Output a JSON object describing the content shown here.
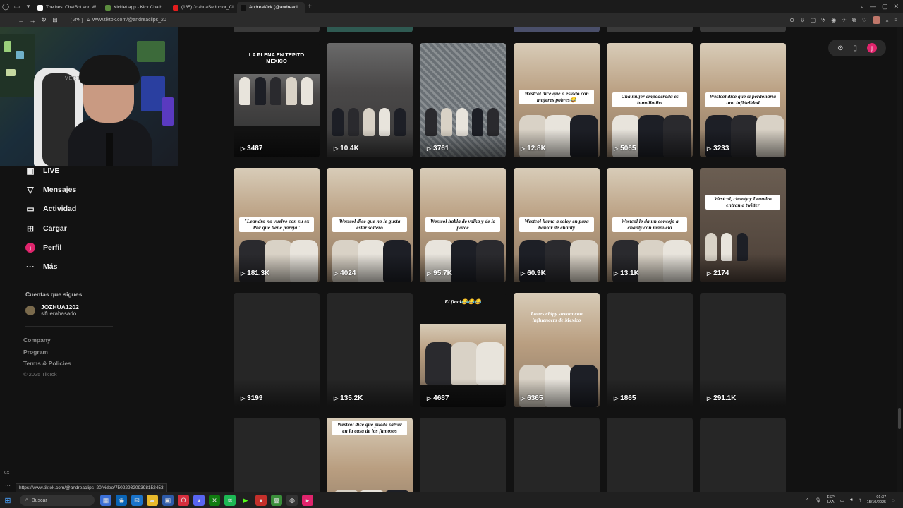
{
  "browser": {
    "tabs": [
      {
        "label": "The best ChatBot and W",
        "color": "#ffffff",
        "active": false
      },
      {
        "label": "Kicklet.app - Kick Chatb",
        "color": "#5b8c3e",
        "active": false
      },
      {
        "label": "(185) JozhuaSeductor_Cl",
        "color": "#e31d1d",
        "active": false
      },
      {
        "label": "AndreaKick (@andreacli",
        "color": "#111111",
        "active": true
      }
    ],
    "new_tab": "+",
    "vpn_label": "VPN",
    "url": "www.tiktok.com/@andreaclips_20",
    "status_url": "https://www.tiktok.com/@andreaclips_20/video/7502293209398152453",
    "zoom_label": "0X"
  },
  "nav": {
    "items": [
      {
        "label": "LIVE",
        "icon": "live-icon",
        "glyph": "▣"
      },
      {
        "label": "Mensajes",
        "icon": "messages-icon",
        "glyph": "▽"
      },
      {
        "label": "Actividad",
        "icon": "activity-icon",
        "glyph": "▭"
      },
      {
        "label": "Cargar",
        "icon": "upload-icon",
        "glyph": "⊞"
      },
      {
        "label": "Perfil",
        "icon": "profile-icon",
        "glyph": "j"
      },
      {
        "label": "Más",
        "icon": "more-icon",
        "glyph": "···"
      }
    ],
    "following_title": "Cuentas que sigues",
    "following": {
      "name": "JOZHUA1202",
      "sub": "sifuerabasado"
    },
    "footer_links": [
      "Company",
      "Program",
      "Terms & Policies"
    ],
    "copyright": "© 2025 TikTok"
  },
  "pill": {
    "profile_letter": "j"
  },
  "videos": [
    {
      "views": "3487",
      "title": "LA PLENA EN TEPITO MEXICO",
      "caption": "",
      "bg": "street"
    },
    {
      "views": "10.4K",
      "title": "",
      "caption": "",
      "bg": "street"
    },
    {
      "views": "3761",
      "title": "",
      "caption": "",
      "bg": "fence"
    },
    {
      "views": "12.8K",
      "title": "",
      "caption": "Westcol dice que a estado con mujeres pobres😂",
      "bg": "room"
    },
    {
      "views": "5065",
      "title": "",
      "caption": "Una mujer empoderada es humillatiba",
      "bg": "room"
    },
    {
      "views": "3233",
      "title": "",
      "caption": "Westcol dice que si perdonaria una infidelidad",
      "bg": "room"
    },
    {
      "views": "181.3K",
      "title": "",
      "caption": "\"Leandro no vuelve con su ex Por que tiene pareja\"",
      "bg": "room"
    },
    {
      "views": "4024",
      "title": "",
      "caption": "Westcol dice que no le gusta estar soltero",
      "bg": "room"
    },
    {
      "views": "95.7K",
      "title": "",
      "caption": "Westcol habla de valka y de la parce",
      "bg": "room"
    },
    {
      "views": "60.9K",
      "title": "",
      "caption": "Westcol llama a soley en para hablar de chanty",
      "bg": "room"
    },
    {
      "views": "13.1K",
      "title": "",
      "caption": "Westcol le da un consejo a chanty con manuela",
      "bg": "room"
    },
    {
      "views": "2174",
      "title": "",
      "caption": "Westcol, chanty y Leandro entran a twitter",
      "bg": "room-dark"
    },
    {
      "views": "3199",
      "title": "",
      "caption": "",
      "bg": "empty"
    },
    {
      "views": "135.2K",
      "title": "",
      "caption": "",
      "bg": "empty"
    },
    {
      "views": "4687",
      "title": "El final😂😂😂",
      "caption": "",
      "bg": "room"
    },
    {
      "views": "6365",
      "title": "",
      "caption": "Lunes chipy stream con influencers de Mexico",
      "bg": "room"
    },
    {
      "views": "1865",
      "title": "",
      "caption": "",
      "bg": "empty"
    },
    {
      "views": "291.1K",
      "title": "",
      "caption": "",
      "bg": "empty"
    },
    {
      "views": "",
      "title": "",
      "caption": "",
      "bg": "empty"
    },
    {
      "views": "",
      "title": "",
      "caption": "Westcol dice que puede salvar en la casa de los famosos",
      "bg": "room"
    },
    {
      "views": "",
      "title": "",
      "caption": "",
      "bg": "empty"
    },
    {
      "views": "",
      "title": "",
      "caption": "",
      "bg": "empty"
    },
    {
      "views": "",
      "title": "",
      "caption": "",
      "bg": "empty"
    },
    {
      "views": "",
      "title": "",
      "caption": "",
      "bg": "empty"
    }
  ],
  "taskbar": {
    "search_placeholder": "Buscar",
    "lang_1": "ESP",
    "lang_2": "LAA",
    "time": "01:37",
    "date": "15/10/2025"
  }
}
